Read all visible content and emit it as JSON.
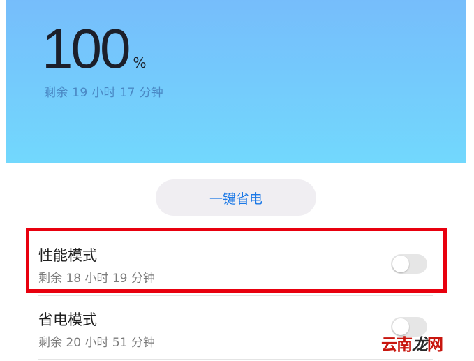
{
  "battery": {
    "percent": "100",
    "unit": "%",
    "remaining": "剩余 19 小时 17 分钟"
  },
  "actions": {
    "one_key_save_label": "一键省电"
  },
  "modes": [
    {
      "title": "性能模式",
      "remaining": "剩余 18 小时 19 分钟",
      "enabled": false
    },
    {
      "title": "省电模式",
      "remaining": "剩余 20 小时 51 分钟",
      "enabled": false
    }
  ],
  "watermark": {
    "text": "云南龙网",
    "part1": "云南",
    "part2": "龙",
    "part3": "网"
  },
  "colors": {
    "header_gradient_top": "#76bdfb",
    "header_gradient_bottom": "#72d8fd",
    "accent_blue": "#1b78e6",
    "highlight_red": "#e8000e"
  }
}
